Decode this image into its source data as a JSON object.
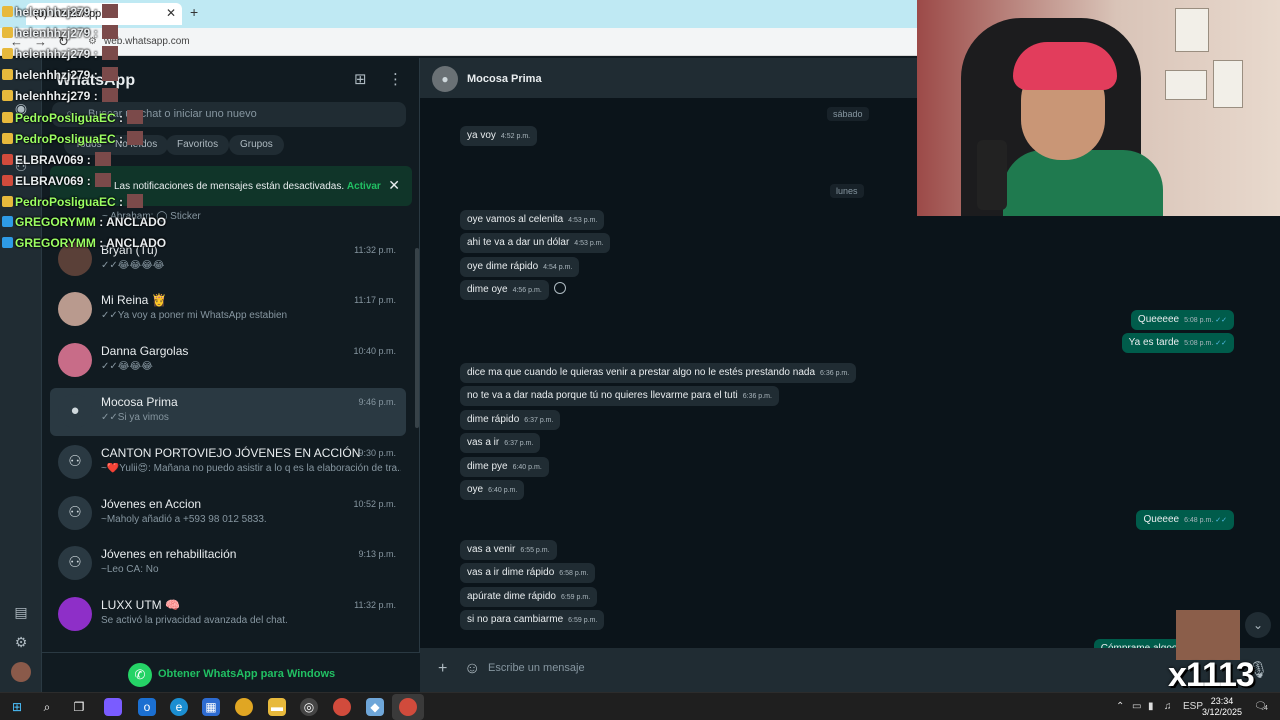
{
  "browser": {
    "tab_title": "(6) WhatsApp",
    "url": "web.whatsapp.com"
  },
  "sidebar": {
    "title": "WhatsApp",
    "search_placeholder": "Buscar un chat o iniciar uno nuevo",
    "filters": [
      "Todos",
      "No leídos",
      "Favoritos",
      "Grupos"
    ],
    "notification": {
      "text": "Las notificaciones de mensajes están desactivadas.",
      "action": "Activar"
    },
    "archived_preview": "~ Abraham: ◯ Sticker",
    "chats": [
      {
        "name": "Bryan (Tú)",
        "time": "11:32 p.m.",
        "preview": "✓✓😂😂😂😂"
      },
      {
        "name": "Mi Reina 👸",
        "time": "11:17 p.m.",
        "preview": "✓✓Ya voy a poner mi WhatsApp estabien"
      },
      {
        "name": "Danna Gargolas",
        "time": "10:40 p.m.",
        "preview": "✓✓😂😂😂"
      },
      {
        "name": "Mocosa Prima",
        "time": "9:46 p.m.",
        "preview": "✓✓Si ya vimos"
      },
      {
        "name": "CANTON PORTOVIEJO JÓVENES EN ACCIÓN",
        "time": "9:30 p.m.",
        "preview": "~❤️Yulii😍: Mañana no puedo asistir a lo q es la elaboración de tra..."
      },
      {
        "name": "Jóvenes en Accion",
        "time": "10:52 p.m.",
        "preview": "~Maholy añadió a +593 98 012 5833."
      },
      {
        "name": "Jóvenes en rehabilitación",
        "time": "9:13 p.m.",
        "preview": "~Leo CA: No"
      },
      {
        "name": "LUXX UTM 🧠",
        "time": "11:32 p.m.",
        "preview": "Se activó la privacidad avanzada del chat."
      }
    ],
    "get_app": "Obtener WhatsApp para Windows"
  },
  "conversation": {
    "contact": "Mocosa Prima",
    "day_labels": [
      "sábado",
      "lunes"
    ],
    "messages": [
      {
        "dir": "in",
        "text": "ya voy",
        "time": "4:52 p.m."
      },
      {
        "dir": "in",
        "text": "oye vamos al celenita",
        "time": "4:53 p.m."
      },
      {
        "dir": "in",
        "text": "ahi te va a dar un dólar",
        "time": "4:53 p.m."
      },
      {
        "dir": "in",
        "text": "oye dime rápido",
        "time": "4:54 p.m."
      },
      {
        "dir": "in",
        "text": "dime oye",
        "time": "4:56 p.m."
      },
      {
        "dir": "out",
        "text": "Queeeee",
        "time": "5:08 p.m."
      },
      {
        "dir": "out",
        "text": "Ya es tarde",
        "time": "5:08 p.m."
      },
      {
        "dir": "in",
        "text": "dice ma que cuando le quieras venir a prestar algo no le estés prestando nada",
        "time": "6:36 p.m."
      },
      {
        "dir": "in",
        "text": "no te va a dar nada porque tú no quieres llevarme para el tuti",
        "time": "6:36 p.m."
      },
      {
        "dir": "in",
        "text": "dime rápido",
        "time": "6:37 p.m."
      },
      {
        "dir": "in",
        "text": "vas a ir",
        "time": "6:37 p.m."
      },
      {
        "dir": "in",
        "text": "dime pye",
        "time": "6:40 p.m."
      },
      {
        "dir": "in",
        "text": "oye",
        "time": "6:40 p.m."
      },
      {
        "dir": "out",
        "text": "Queeee",
        "time": "6:48 p.m."
      },
      {
        "dir": "in",
        "text": "vas a venir",
        "time": "6:55 p.m."
      },
      {
        "dir": "in",
        "text": "vas a ir dime rápido",
        "time": "6:58 p.m."
      },
      {
        "dir": "in",
        "text": "apúrate dime rápido",
        "time": "6:59 p.m."
      },
      {
        "dir": "in",
        "text": "si no para cambiarme",
        "time": "6:59 p.m."
      },
      {
        "dir": "out",
        "text": "Cómprame algooo",
        "time": ""
      }
    ],
    "composer_placeholder": "Escribe un mensaje"
  },
  "stream_overlay": {
    "lines": [
      {
        "user": "helenhhzj279",
        "sep": " :",
        "color": "white"
      },
      {
        "user": "helenhhzj279",
        "sep": " :",
        "color": "white"
      },
      {
        "user": "helenhhzj279",
        "sep": " :",
        "color": "white"
      },
      {
        "user": "helenhhzj279",
        "sep": " :",
        "color": "white"
      },
      {
        "user": "helenhhzj279",
        "sep": " :",
        "color": "white"
      },
      {
        "user": "PedroPosliguaEC",
        "sep": " :",
        "color": "green"
      },
      {
        "user": "PedroPosliguaEC",
        "sep": " :",
        "color": "green"
      },
      {
        "user": "ELBRAV069",
        "sep": " :",
        "color": "white"
      },
      {
        "user": "ELBRAV069",
        "sep": " :",
        "color": "white"
      },
      {
        "user": "PedroPosliguaEC",
        "sep": " :",
        "color": "green"
      },
      {
        "user": "GREGORYMM",
        "sep": " : ANCLADO",
        "color": "green"
      },
      {
        "user": "GREGORYMM",
        "sep": " : ANCLADO",
        "color": "green"
      }
    ],
    "counter": "x1113"
  },
  "taskbar": {
    "language": "ESP",
    "time": "23:34",
    "date": "3/12/2025",
    "notification_count": "4"
  },
  "colors": {
    "wa_green": "#21c063",
    "wa_bg": "#0b141a",
    "bubble_in": "#202c33",
    "bubble_out": "#005c4b"
  }
}
